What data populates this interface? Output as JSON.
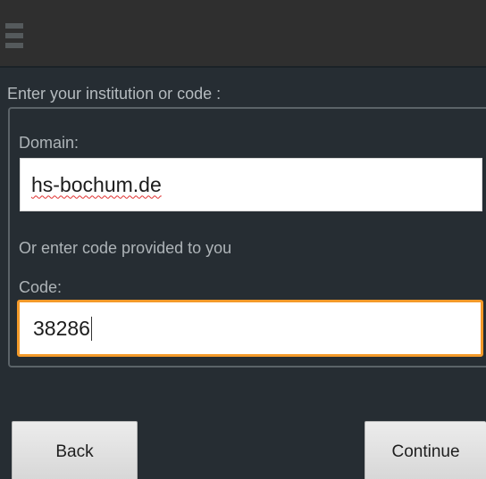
{
  "screen": {
    "prompt": "Enter your institution or code :",
    "domain": {
      "label": "Domain:",
      "value": "hs-bochum.de"
    },
    "or_text": "Or enter code provided to you",
    "code": {
      "label": "Code:",
      "value": "38286"
    },
    "buttons": {
      "back": "Back",
      "continue": "Continue"
    }
  },
  "icons": {
    "menu": "menu-icon"
  },
  "colors": {
    "background": "#262d33",
    "action_bar": "#2f2f2f",
    "focus_border": "#f39a2a",
    "spellcheck_underline": "#e0302f"
  }
}
